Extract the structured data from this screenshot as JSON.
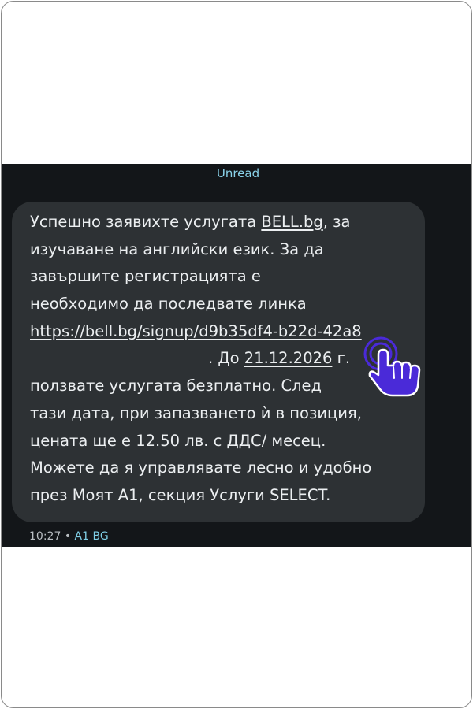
{
  "divider": {
    "label": "Unread"
  },
  "message": {
    "l1_a": "Успешно заявихте услугата ",
    "l1_link": "BELL.bg",
    "l1_b": ", за",
    "l2": "изучаване на английски език. За да",
    "l3": "завършите регистрацията е",
    "l4": "необходимо да последвате линка",
    "l5_link": "https://bell.bg/signup/d9b35df4-b22d-42a8",
    "l6_dot": ".",
    "l6_a": ". До ",
    "l6_date": "21.12.2026",
    "l6_b": " г.",
    "l7": "ползвате услугата безплатно. След",
    "l8": "тази дата, при запазването ѝ в позиция,",
    "l9": "цената ще е 12.50 лв. с ДДС/ месец.",
    "l10": "Можете да я управлявате лесно и удобно",
    "l11": "през Моят А1, секция  Услуги SELECT."
  },
  "meta": {
    "time": "10:27",
    "separator": "•",
    "sender": "A1 BG"
  },
  "colors": {
    "accent": "#7fcfe6",
    "bubble": "#2d3134",
    "background": "#131619",
    "pointer": "#4a2ad8"
  },
  "icons": {
    "pointer": "tap-hand-icon"
  }
}
